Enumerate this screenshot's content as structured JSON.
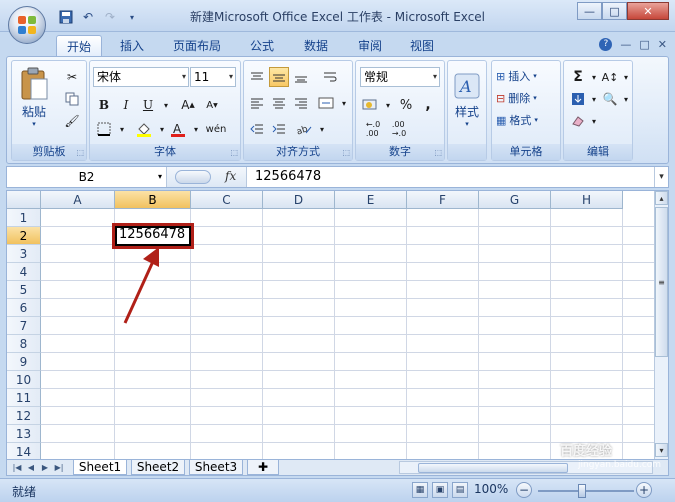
{
  "window": {
    "title": "新建Microsoft Office Excel 工作表 - Microsoft Excel",
    "controls": [
      "—",
      "□",
      "✕"
    ]
  },
  "ribbon_tabs": [
    {
      "label": "开始",
      "active": true
    },
    {
      "label": "插入",
      "active": false
    },
    {
      "label": "页面布局",
      "active": false
    },
    {
      "label": "公式",
      "active": false
    },
    {
      "label": "数据",
      "active": false
    },
    {
      "label": "审阅",
      "active": false
    },
    {
      "label": "视图",
      "active": false
    }
  ],
  "ribbon": {
    "clipboard": {
      "label": "剪贴板",
      "paste": "粘贴"
    },
    "font": {
      "label": "字体",
      "font_name": "宋体",
      "font_size": "11",
      "bold": "B",
      "italic": "I",
      "underline": "U"
    },
    "alignment": {
      "label": "对齐方式"
    },
    "number": {
      "label": "数字",
      "format": "常规",
      "percent": "%",
      "comma": ","
    },
    "styles": {
      "label": "样式"
    },
    "cells": {
      "label": "单元格",
      "insert": "插入",
      "delete": "删除",
      "format": "格式"
    },
    "editing": {
      "label": "编辑"
    }
  },
  "formula_bar": {
    "name_box": "B2",
    "fx": "fx",
    "value": "12566478"
  },
  "grid": {
    "columns": [
      "A",
      "B",
      "C",
      "D",
      "E",
      "F",
      "G",
      "H"
    ],
    "rows": [
      "1",
      "2",
      "3",
      "4",
      "5",
      "6",
      "7",
      "8",
      "9",
      "10",
      "11",
      "12",
      "13",
      "14"
    ],
    "selected_column": "B",
    "selected_row": "2",
    "active_cell_value": "12566478"
  },
  "sheets": [
    "Sheet1",
    "Sheet2",
    "Sheet3"
  ],
  "status": {
    "ready": "就绪",
    "zoom": "100%"
  },
  "watermark": {
    "text": "百度经验",
    "url": "jingyan.baidu.com"
  }
}
